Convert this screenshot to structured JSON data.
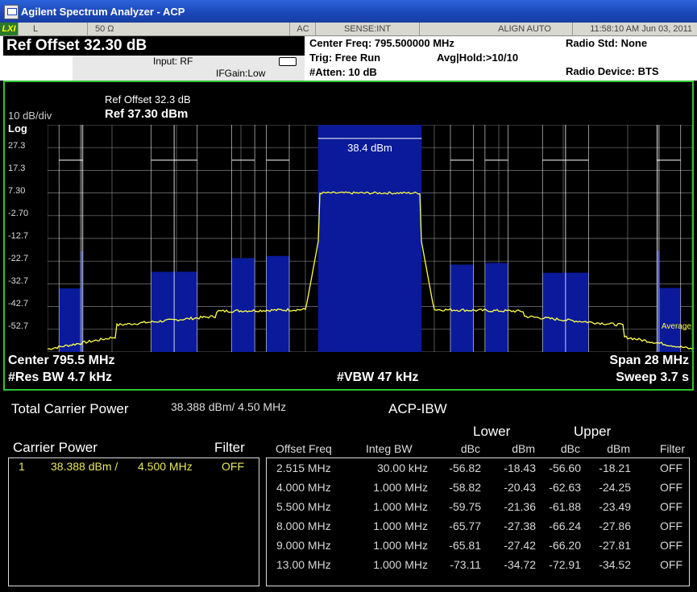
{
  "window": {
    "title": "Agilent Spectrum Analyzer - ACP"
  },
  "status_bar": {
    "lxi": "LXI",
    "coupling_l": "L",
    "impedance": "50 Ω",
    "ac": "AC",
    "sense": "SENSE:INT",
    "align": "ALIGN AUTO",
    "datetime": "11:58:10 AM Jun 03, 2011"
  },
  "header": {
    "ref_offset": "Ref Offset  32.30 dB",
    "input": "Input: RF",
    "ifgain": "IFGain:Low",
    "center_freq": "Center Freq: 795.500000 MHz",
    "trig": "Trig: Free Run",
    "avg_hold": "Avg|Hold:>10/10",
    "atten": "#Atten: 10 dB",
    "radio_std": "Radio Std: None",
    "radio_device": "Radio Device: BTS"
  },
  "graph": {
    "scale_div": "10 dB/div",
    "scale_type": "Log",
    "ref_offset_note": "Ref Offset 32.3 dB",
    "ref_level": "Ref 37.30 dBm",
    "carrier_label": "38.4 dBm",
    "average_label": "Average",
    "center": "Center  795.5 MHz",
    "res_bw": "#Res BW  4.7 kHz",
    "vbw": "#VBW  47 kHz",
    "span": "Span 28 MHz",
    "sweep": "Sweep  3.7 s",
    "y_ticks": [
      "27.3",
      "17.3",
      "7.30",
      "-2.70",
      "-12.7",
      "-22.7",
      "-32.7",
      "-42.7",
      "-52.7"
    ],
    "colors": {
      "frame": "#2ec42e",
      "bars": "#0a1a9a",
      "trace": "#ffff4a",
      "grid": "#9a9a9a"
    }
  },
  "chart_data": {
    "type": "bar",
    "title": "",
    "xlabel": "",
    "ylabel": "",
    "ylim": [
      -62.7,
      37.3
    ],
    "xlim": [
      781.5,
      809.5
    ],
    "series": [
      {
        "name": "Carrier",
        "x": [
          795.5
        ],
        "values": [
          38.4
        ]
      },
      {
        "name": "Lower",
        "x": [
          782.985,
          791.5,
          790.0,
          787.5,
          786.5,
          782.5
        ],
        "values": [
          -56.82,
          -58.82,
          -59.75,
          -65.77,
          -65.81,
          -73.11
        ]
      },
      {
        "name": "Upper",
        "x": [
          808.015,
          799.5,
          801.0,
          803.5,
          804.5,
          808.5
        ],
        "values": [
          -56.6,
          -62.63,
          -61.88,
          -66.24,
          -66.2,
          -72.91
        ]
      }
    ]
  },
  "results": {
    "total_carrier_power_label": "Total Carrier Power",
    "total_carrier_power_value": "38.388 dBm/ 4.50 MHz",
    "mode": "ACP-IBW",
    "carrier_power_label": "Carrier Power",
    "filter_label": "Filter",
    "carrier": {
      "index": "1",
      "power": "38.388 dBm /",
      "bw": "4.500 MHz",
      "filter": "OFF"
    },
    "lower_label": "Lower",
    "upper_label": "Upper",
    "columns": [
      "Offset Freq",
      "Integ BW",
      "dBc",
      "dBm",
      "dBc",
      "dBm",
      "Filter"
    ],
    "rows": [
      {
        "offset": "2.515 MHz",
        "integ_bw": "30.00 kHz",
        "lower_dbc": "-56.82",
        "lower_dbm": "-18.43",
        "upper_dbc": "-56.60",
        "upper_dbm": "-18.21",
        "filter": "OFF"
      },
      {
        "offset": "4.000 MHz",
        "integ_bw": "1.000 MHz",
        "lower_dbc": "-58.82",
        "lower_dbm": "-20.43",
        "upper_dbc": "-62.63",
        "upper_dbm": "-24.25",
        "filter": "OFF"
      },
      {
        "offset": "5.500 MHz",
        "integ_bw": "1.000 MHz",
        "lower_dbc": "-59.75",
        "lower_dbm": "-21.36",
        "upper_dbc": "-61.88",
        "upper_dbm": "-23.49",
        "filter": "OFF"
      },
      {
        "offset": "8.000 MHz",
        "integ_bw": "1.000 MHz",
        "lower_dbc": "-65.77",
        "lower_dbm": "-27.38",
        "upper_dbc": "-66.24",
        "upper_dbm": "-27.86",
        "filter": "OFF"
      },
      {
        "offset": "9.000 MHz",
        "integ_bw": "1.000 MHz",
        "lower_dbc": "-65.81",
        "lower_dbm": "-27.42",
        "upper_dbc": "-66.20",
        "upper_dbm": "-27.81",
        "filter": "OFF"
      },
      {
        "offset": "13.00 MHz",
        "integ_bw": "1.000 MHz",
        "lower_dbc": "-73.11",
        "lower_dbm": "-34.72",
        "upper_dbc": "-72.91",
        "upper_dbm": "-34.52",
        "filter": "OFF"
      }
    ]
  }
}
